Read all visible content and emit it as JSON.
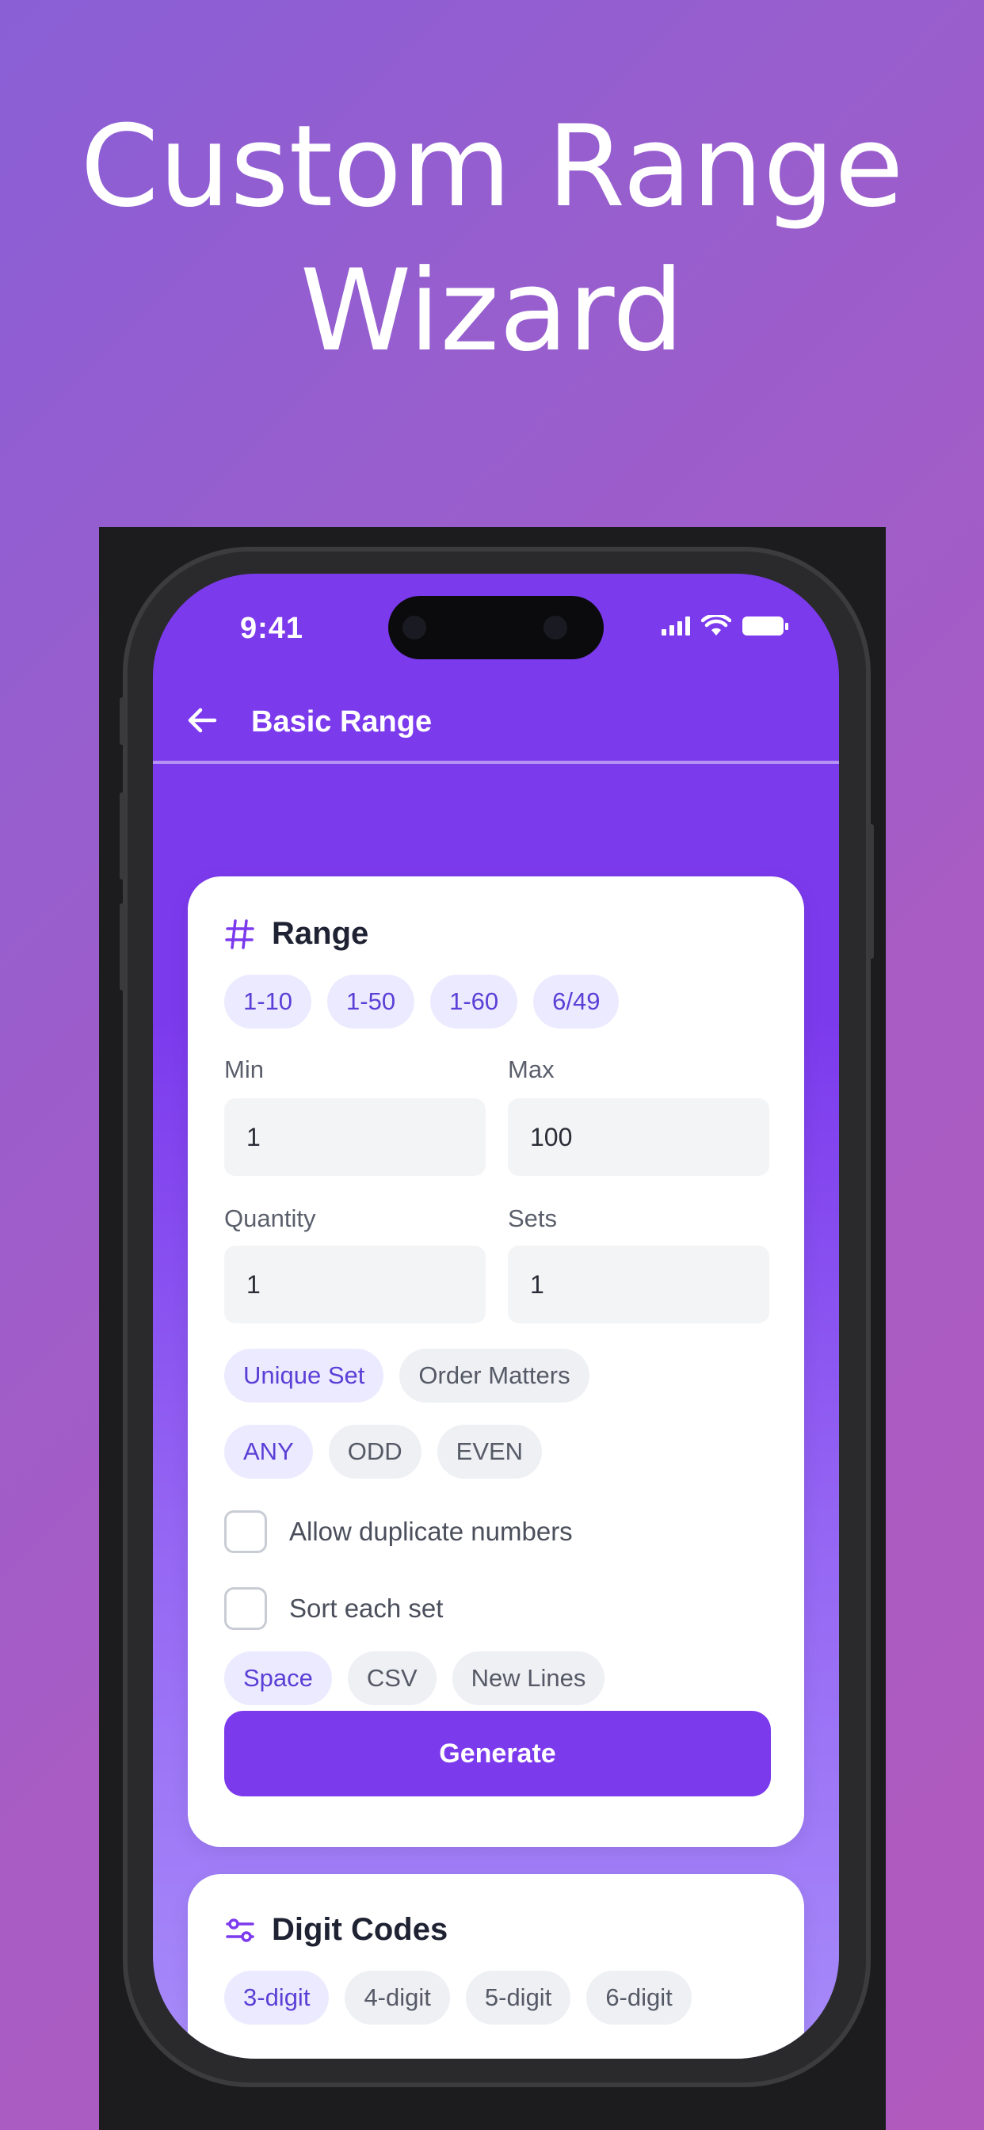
{
  "promo": {
    "line1": "Custom Range",
    "line2": "Wizard"
  },
  "status_bar": {
    "time": "9:41"
  },
  "app_bar": {
    "title": "Basic Range",
    "back_icon": "arrow-left-icon"
  },
  "range_card": {
    "title": "Range",
    "icon": "hash-icon",
    "presets": [
      "1-10",
      "1-50",
      "1-60",
      "6/49"
    ],
    "min": {
      "label": "Min",
      "value": "1"
    },
    "max": {
      "label": "Max",
      "value": "100"
    },
    "quantity": {
      "label": "Quantity",
      "value": "1"
    },
    "sets": {
      "label": "Sets",
      "value": "1"
    },
    "mode_options": [
      "Unique Set",
      "Order Matters"
    ],
    "mode_selected": "Unique Set",
    "parity_options": [
      "ANY",
      "ODD",
      "EVEN"
    ],
    "parity_selected": "ANY",
    "allow_duplicates": {
      "label": "Allow duplicate numbers",
      "checked": false
    },
    "sort_each": {
      "label": "Sort each set",
      "checked": false
    },
    "format_options": [
      "Space",
      "CSV",
      "New Lines"
    ],
    "format_selected": "Space",
    "generate_label": "Generate"
  },
  "digit_card": {
    "title": "Digit Codes",
    "icon": "sliders-icon",
    "options": [
      "3-digit",
      "4-digit",
      "5-digit",
      "6-digit"
    ]
  },
  "colors": {
    "accent": "#7c3aed",
    "chip_selected_bg": "#eceaff",
    "chip_bg": "#eef0f4"
  }
}
